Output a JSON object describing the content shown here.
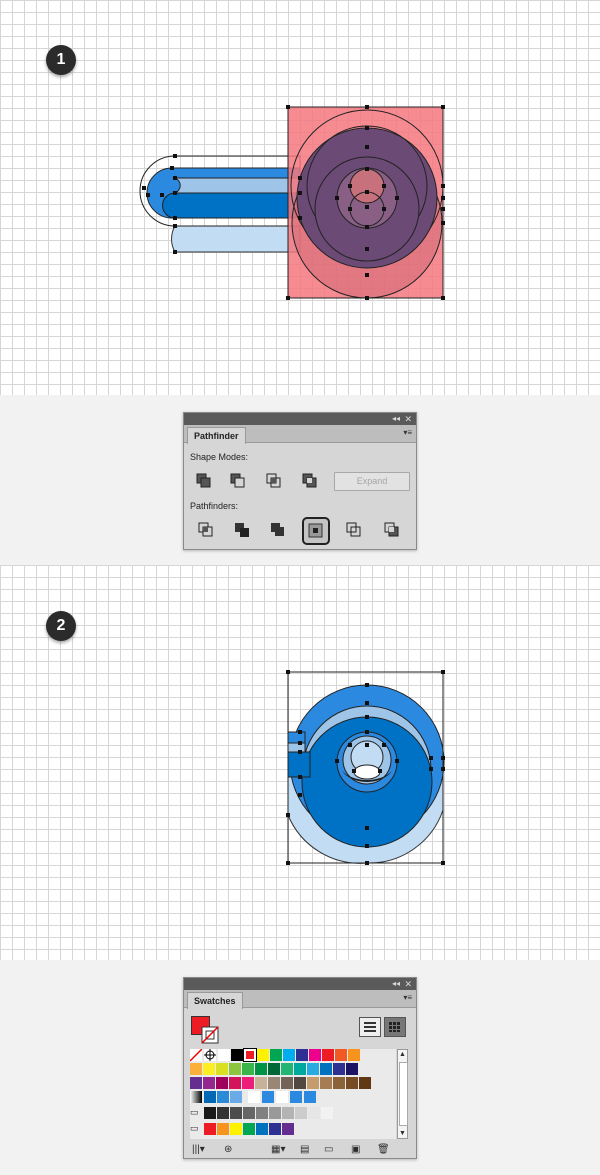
{
  "steps": [
    {
      "number": "1"
    },
    {
      "number": "2"
    }
  ],
  "pathfinder_panel": {
    "tab_label": "Pathfinder",
    "collapse_glyph": "◂◂",
    "close_glyph": "✕",
    "menu_glyph": "▾≡",
    "shape_modes_label": "Shape Modes:",
    "pathfinders_label": "Pathfinders:",
    "expand_label": "Expand",
    "shape_mode_buttons": [
      "unite-icon",
      "minus-front-icon",
      "intersect-icon",
      "exclude-icon"
    ],
    "pathfinder_buttons": [
      "divide-icon",
      "trim-icon",
      "merge-icon",
      "crop-icon",
      "outline-icon",
      "minus-back-icon"
    ],
    "selected_pathfinder": "crop-icon"
  },
  "swatches_panel": {
    "tab_label": "Swatches",
    "collapse_glyph": "◂◂",
    "close_glyph": "✕",
    "menu_glyph": "▾≡",
    "fill_color": "#ed1c24",
    "colors_row1": [
      "#ffffff",
      "#000000",
      "#ed1c24",
      "#fff200",
      "#00a651",
      "#00aeef",
      "#2e3192",
      "#ec008c",
      "#ed1c24",
      "#f15a24",
      "#f7941d"
    ],
    "colors_row2": [
      "#fbb03b",
      "#fcee21",
      "#d9e021",
      "#8cc63f",
      "#39b54a",
      "#009245",
      "#006837",
      "#22b573",
      "#00a99d",
      "#29abe2",
      "#0071bc",
      "#2e3192",
      "#1b1464"
    ],
    "colors_row3": [
      "#662d91",
      "#93278f",
      "#9e005d",
      "#d4145a",
      "#ed1e79",
      "#c7b299",
      "#998675",
      "#736357",
      "#534741",
      "#c69c6d",
      "#a67c52",
      "#8c6239",
      "#754c24",
      "#603813"
    ],
    "colors_row4": [
      "#0068b5",
      "#2a8ad8",
      "#6aaae6"
    ],
    "grays_row": [
      "#1a1a1a",
      "#333333",
      "#4d4d4d",
      "#666666",
      "#808080",
      "#999999",
      "#b3b3b3",
      "#cccccc",
      "#e6e6e6",
      "#f2f2f2"
    ],
    "group_row": [
      "#ed1c24",
      "#f7941d",
      "#fff200",
      "#00a651",
      "#0071bc",
      "#2e3192",
      "#662d91"
    ]
  },
  "art_colors": {
    "blue_dark": "#0072c6",
    "blue_mid": "#2b8ae0",
    "blue_light": "#9ec4e8",
    "blue_pale": "#c2dcf3",
    "pink": "#f5787f",
    "purple": "#6b4a76"
  }
}
